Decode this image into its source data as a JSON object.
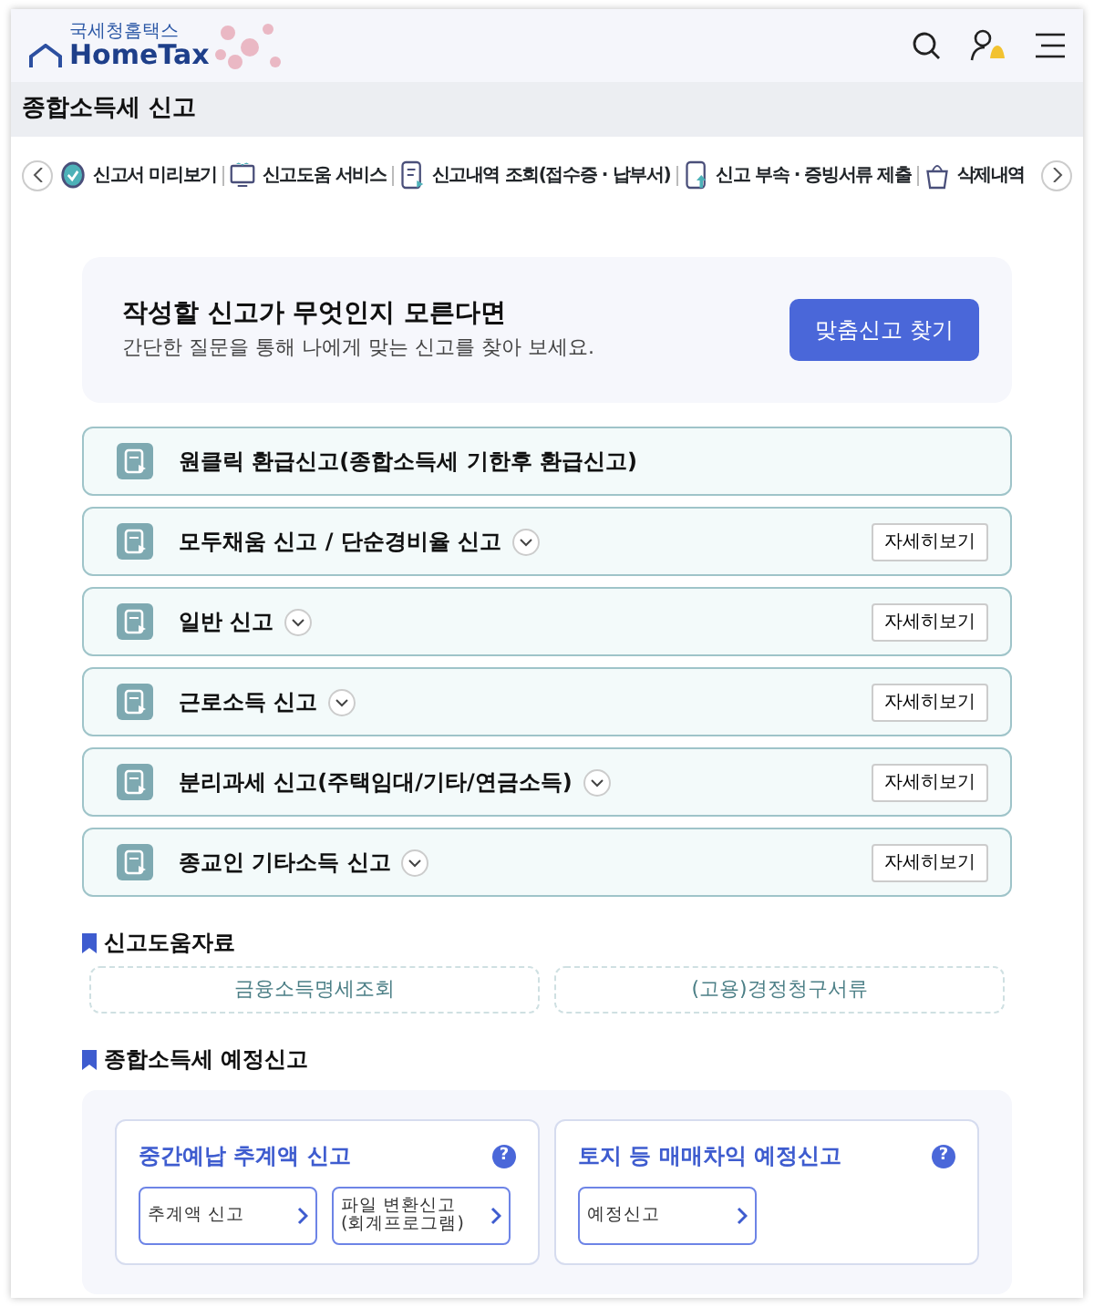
{
  "header": {
    "logo_small": "국세청홈택스",
    "logo": "HomeTax"
  },
  "page_title": "종합소득세 신고",
  "toolbar": [
    {
      "label": "신고서 미리보기"
    },
    {
      "label": "신고도움 서비스"
    },
    {
      "label": "신고내역 조회(접수증 · 납부서)"
    },
    {
      "label": "신고 부속 · 증빙서류 제출"
    },
    {
      "label": "삭제내역"
    }
  ],
  "banner": {
    "title": "작성할 신고가 무엇인지 모른다면",
    "subtitle": "간단한 질문을 통해 나에게 맞는 신고를 찾아 보세요.",
    "button": "맞춤신고 찾기"
  },
  "filings": [
    {
      "label": "원클릭 환급신고(종합소득세 기한후 환급신고)",
      "kind": "plain"
    },
    {
      "label": "모두채움 신고 / 단순경비율 신고",
      "kind": "expandable",
      "detail": "자세히보기"
    },
    {
      "label": "일반 신고",
      "kind": "expandable",
      "detail": "자세히보기"
    },
    {
      "label": "근로소득 신고",
      "kind": "expandable",
      "detail": "자세히보기"
    },
    {
      "label": "분리과세 신고(주택임대/기타/연금소득)",
      "kind": "expandable",
      "detail": "자세히보기"
    },
    {
      "label": "종교인 기타소득 신고",
      "kind": "expandable",
      "detail": "자세히보기"
    }
  ],
  "help_section": {
    "title": "신고도움자료",
    "links": [
      "금융소득명세조회",
      "(고용)경정청구서류"
    ]
  },
  "estimate_section": {
    "title": "종합소득세 예정신고",
    "cards": [
      {
        "title": "중간예납 추계액 신고",
        "help": "?",
        "links": [
          "추계액 신고",
          "파일 변환신고\n(회계프로그램)"
        ]
      },
      {
        "title": "토지 등 매매차익 예정신고",
        "help": "?",
        "links": [
          "예정신고"
        ]
      }
    ]
  }
}
